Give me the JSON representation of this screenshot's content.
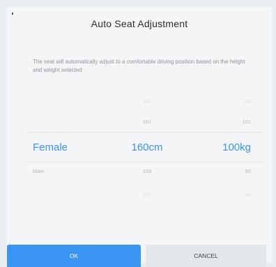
{
  "dialog": {
    "title": "Auto Seat Adjustment",
    "description": "The seat will automatically adjust to a comfortable driving position based on the height and weight selected"
  },
  "picker": {
    "gender": {
      "items": [
        "Female",
        "Male"
      ]
    },
    "height": {
      "items": [
        "162",
        "161",
        "160cm",
        "159",
        "155"
      ]
    },
    "weight": {
      "items": [
        "102",
        "101",
        "100kg",
        "90",
        "98"
      ]
    }
  },
  "buttons": {
    "ok": "OK",
    "cancel": "CANCEL"
  },
  "colors": {
    "accent": "#3a94f2",
    "background": "#f3f5f7"
  }
}
